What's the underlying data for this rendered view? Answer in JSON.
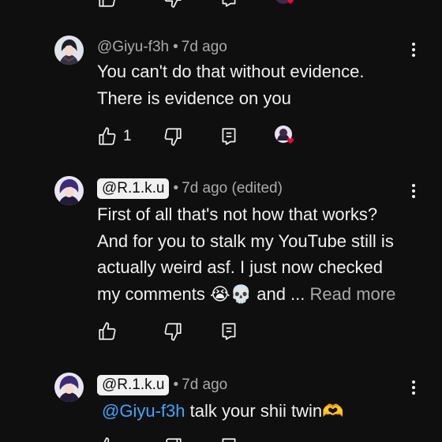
{
  "comments": [
    {
      "handle": "@Giyu-f3h",
      "time": "7d ago",
      "lines": [
        "You can't do that without evidence.",
        "There is evidence on you"
      ],
      "like_count": "1"
    },
    {
      "handle": "@R.1.k.u",
      "time": "7d ago (edited)",
      "lines": [
        "First of all that's not how that works?",
        "And for you to stalk my YouTube still is",
        "actually weird asf. I just now checked",
        "my comments 😭💀 and ... "
      ],
      "read_more": "Read more"
    },
    {
      "handle": "@R.1.k.u",
      "time": "7d ago",
      "mention": "@Giyu-f3h",
      "text": " talk your shii twin🫶"
    }
  ],
  "colors": {
    "background": "#0f0f0f",
    "text": "#f1f1f1",
    "secondary": "#aaaaaa",
    "mention": "#3ea6ff",
    "heart": "#ff0033"
  },
  "icons": {
    "like": "thumbs-up-icon",
    "dislike": "thumbs-down-icon",
    "reply": "reply-icon",
    "menu": "more-vert-icon",
    "creator_heart": "creator-heart-icon"
  }
}
